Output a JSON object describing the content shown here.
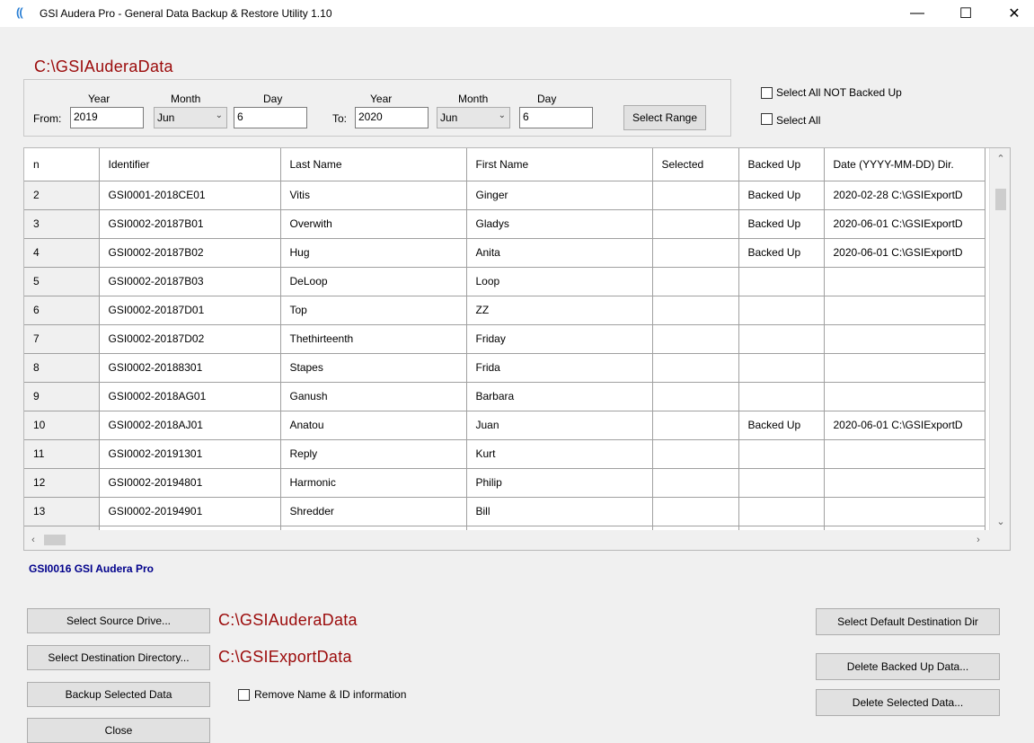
{
  "window": {
    "title": "GSI Audera Pro - General Data Backup & Restore Utility  1.10",
    "icon": "signal-waves-icon",
    "minimize_glyph": "—",
    "maximize_glyph": "☐",
    "close_glyph": "✕"
  },
  "source_path_header": "C:\\GSIAuderaData",
  "range": {
    "col_year": "Year",
    "col_month": "Month",
    "col_day": "Day",
    "from_label": "From:",
    "to_label": "To:",
    "from_year": "2019",
    "from_month": "Jun",
    "from_day": "6",
    "to_year": "2020",
    "to_month": "Jun",
    "to_day": "6",
    "select_range_label": "Select Range"
  },
  "checks": {
    "select_all_not_backed_up": "Select All NOT Backed Up",
    "select_all": "Select All"
  },
  "grid": {
    "columns": [
      "n",
      "Identifier",
      "Last Name",
      "First Name",
      "Selected",
      "Backed Up",
      "Date (YYYY-MM-DD) Dir."
    ],
    "rows": [
      [
        "2",
        "GSI0001-2018CE01",
        "Vitis",
        "Ginger",
        "",
        "Backed Up",
        "2020-02-28   C:\\GSIExportD"
      ],
      [
        "3",
        "GSI0002-20187B01",
        "Overwith",
        "Gladys",
        "",
        "Backed Up",
        "2020-06-01   C:\\GSIExportD"
      ],
      [
        "4",
        "GSI0002-20187B02",
        "Hug",
        "Anita",
        "",
        "Backed Up",
        "2020-06-01   C:\\GSIExportD"
      ],
      [
        "5",
        "GSI0002-20187B03",
        "DeLoop",
        "Loop",
        "",
        "",
        ""
      ],
      [
        "6",
        "GSI0002-20187D01",
        "Top",
        "ZZ",
        "",
        "",
        ""
      ],
      [
        "7",
        "GSI0002-20187D02",
        "Thethirteenth",
        "Friday",
        "",
        "",
        ""
      ],
      [
        "8",
        "GSI0002-20188301",
        "Stapes",
        "Frida",
        "",
        "",
        ""
      ],
      [
        "9",
        "GSI0002-2018AG01",
        "Ganush",
        "Barbara",
        "",
        "",
        ""
      ],
      [
        "10",
        "GSI0002-2018AJ01",
        "Anatou",
        "Juan",
        "",
        "Backed Up",
        "2020-06-01   C:\\GSIExportD"
      ],
      [
        "11",
        "GSI0002-20191301",
        "Reply",
        "Kurt",
        "",
        "",
        ""
      ],
      [
        "12",
        "GSI0002-20194801",
        "Harmonic",
        "Philip",
        "",
        "",
        ""
      ],
      [
        "13",
        "GSI0002-20194901",
        "Shredder",
        "Bill",
        "",
        "",
        ""
      ]
    ]
  },
  "status_line": "GSI0016   GSI Audera Pro",
  "actions": {
    "select_source_label": "Select Source Drive...",
    "source_path": "C:\\GSIAuderaData",
    "select_dest_label": "Select Destination Directory...",
    "dest_path": "C:\\GSIExportData",
    "backup_label": "Backup Selected Data",
    "remove_name_label": "Remove Name & ID information",
    "close_label": "Close",
    "select_default_dest_label": "Select Default Destination Dir",
    "delete_backed_up_label": "Delete Backed Up Data...",
    "delete_selected_label": "Delete Selected Data..."
  }
}
